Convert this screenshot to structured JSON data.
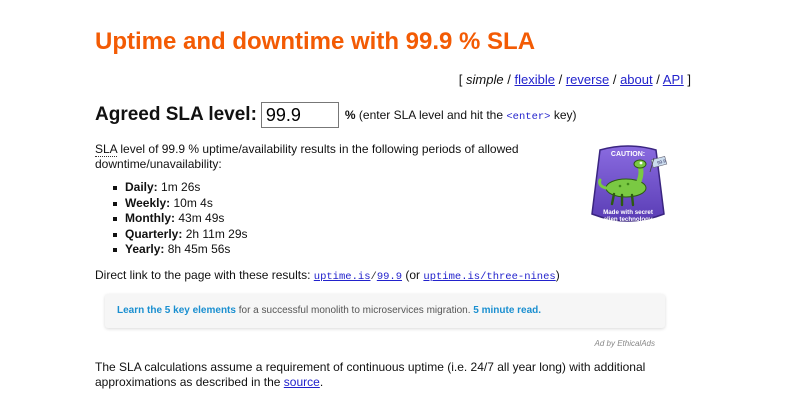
{
  "title": "Uptime and downtime with 99.9 % SLA",
  "modes": {
    "open_bracket": "[",
    "current": "simple",
    "sep": "/",
    "links": [
      "flexible",
      "reverse",
      "about",
      "API"
    ],
    "close_bracket": "]"
  },
  "sla": {
    "label": "Agreed SLA level:",
    "value": "99.9",
    "pct": "%",
    "hint_before": "(enter SLA level and hit the",
    "hint_key": "<enter>",
    "hint_after": "key)"
  },
  "intro": {
    "abbr": "SLA",
    "text": "level of 99.9 % uptime/availability results in the following periods of allowed downtime/unavailability:"
  },
  "results": [
    {
      "label": "Daily:",
      "value": "1m 26s"
    },
    {
      "label": "Weekly:",
      "value": "10m 4s"
    },
    {
      "label": "Monthly:",
      "value": "43m 49s"
    },
    {
      "label": "Quarterly:",
      "value": "2h 11m 29s"
    },
    {
      "label": "Yearly:",
      "value": "8h 45m 56s"
    }
  ],
  "direct": {
    "prefix": "Direct link to the page with these results:",
    "link1_a": "uptime.is",
    "link1_sep": "/",
    "link1_b": "99.9",
    "or_text": "(or",
    "link2": "uptime.is/three-nines",
    "close": ")"
  },
  "ad": {
    "link_text": "Learn the 5 key elements",
    "middle": "for a successful monolith to microservices migration.",
    "read_text": "5 minute read.",
    "by": "Ad by EthicalAds"
  },
  "badge": {
    "caution": "CAUTION:",
    "line1": "Made with secret",
    "line2": "alien technology",
    "flag": "99.9"
  },
  "footer": {
    "text": "The SLA calculations assume a requirement of continuous uptime (i.e. 24/7 all year long) with additional approximations as described in the",
    "link": "source",
    "end": "."
  },
  "colors": {
    "title": "#f35b04",
    "link": "#2222cc",
    "ad_link": "#1a8fd0",
    "badge_purple": "#6a4cc7",
    "alien_green": "#7ac943"
  }
}
